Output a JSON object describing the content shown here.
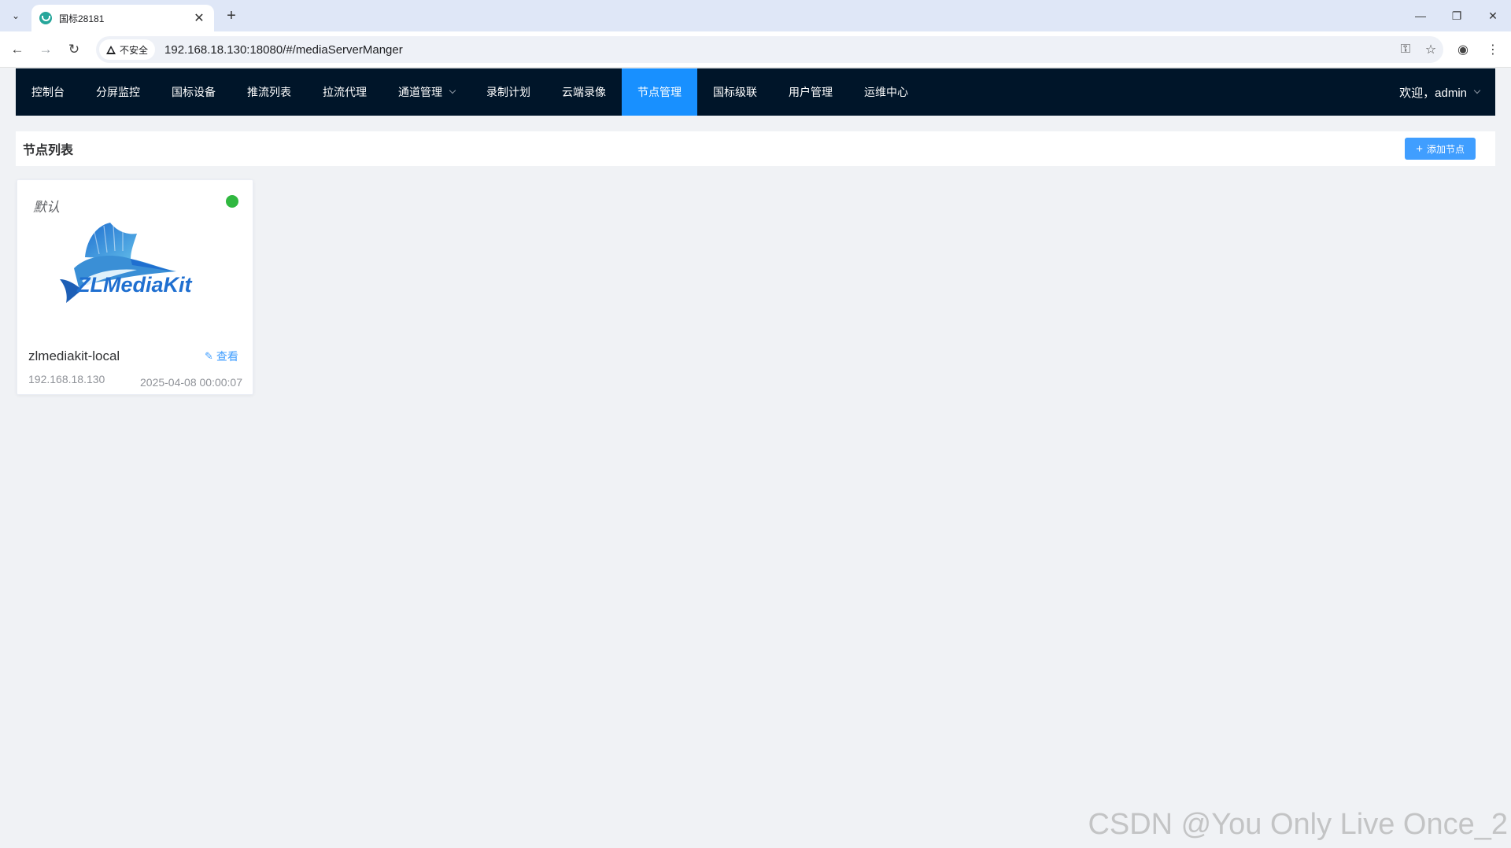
{
  "browser": {
    "tab_title": "国标28181",
    "tab_close": "✕",
    "new_tab": "+",
    "security_label": "不安全",
    "url": "192.168.18.130:18080/#/mediaServerManger"
  },
  "nav": {
    "items": [
      {
        "label": "控制台"
      },
      {
        "label": "分屏监控"
      },
      {
        "label": "国标设备"
      },
      {
        "label": "推流列表"
      },
      {
        "label": "拉流代理"
      },
      {
        "label": "通道管理"
      },
      {
        "label": "录制计划"
      },
      {
        "label": "云端录像"
      },
      {
        "label": "节点管理"
      },
      {
        "label": "国标级联"
      },
      {
        "label": "用户管理"
      },
      {
        "label": "运维中心"
      }
    ],
    "active": "节点管理",
    "user": "欢迎，admin",
    "active_color": "#1890ff",
    "bg_color": "#001529"
  },
  "page": {
    "title": "节点列表",
    "add_button": "添加节点"
  },
  "node": {
    "default_tag": "默认",
    "logo_text": "ZLMediaKit",
    "name": "zlmediakit-local",
    "view_label": "查看",
    "ip": "192.168.18.130",
    "time": "2025-04-08 00:00:07",
    "status": "online",
    "status_color": "#30b840"
  },
  "watermark": "CSDN @You Only Live Once_2"
}
